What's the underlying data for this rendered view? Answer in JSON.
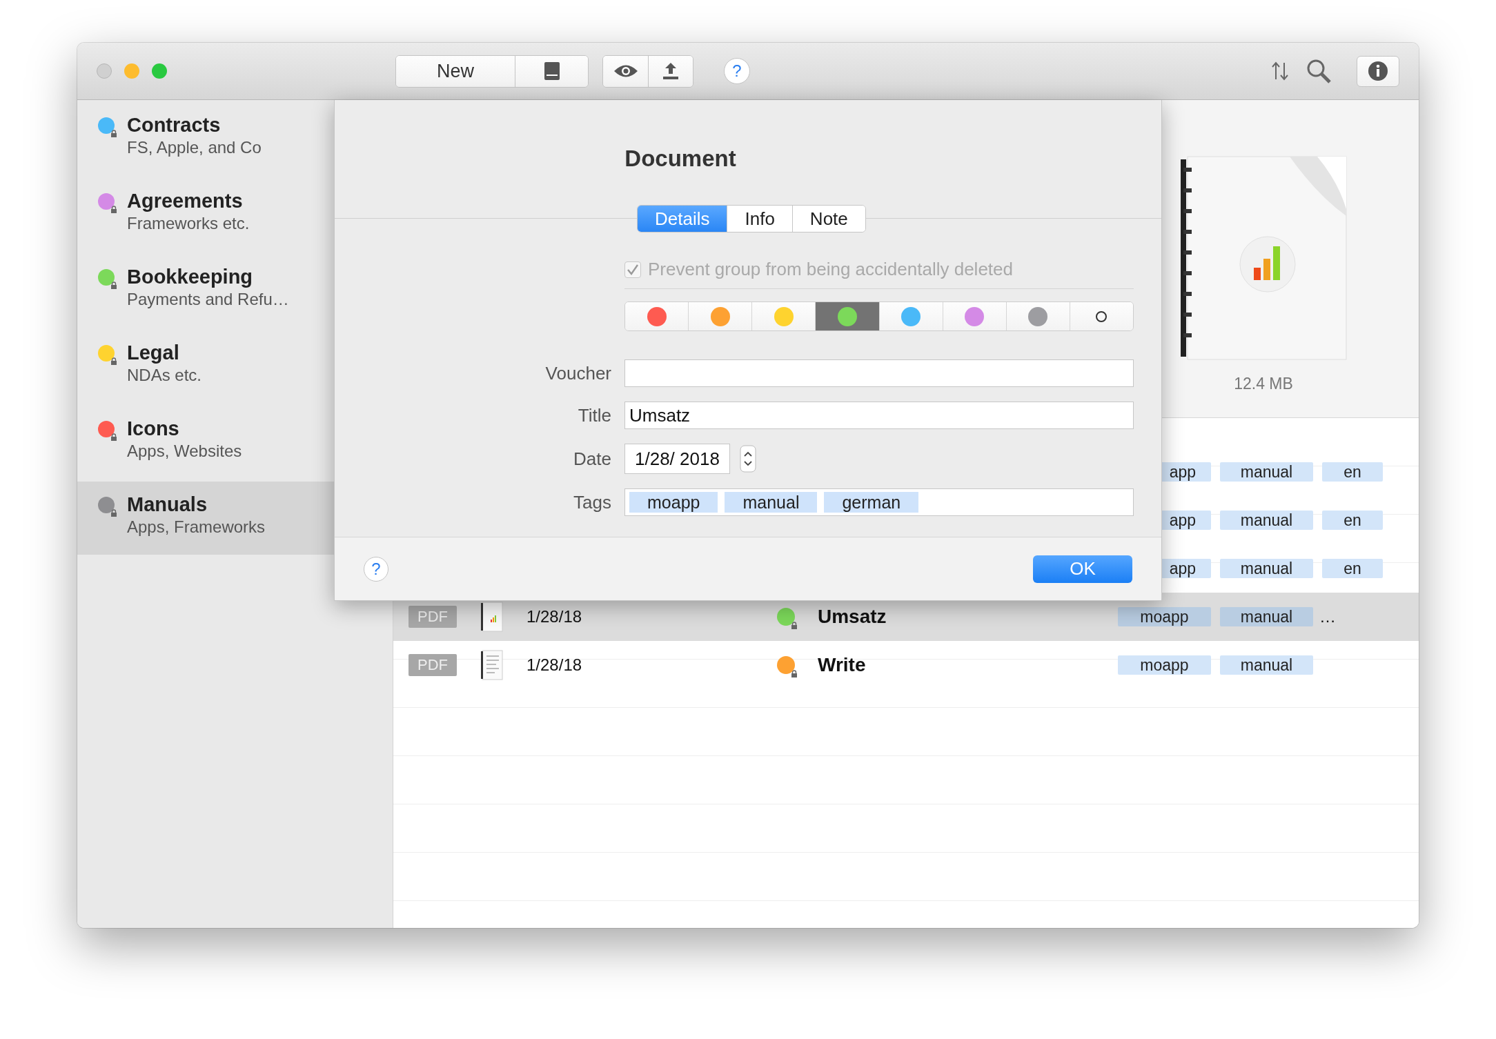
{
  "toolbar": {
    "new_button": "New",
    "help": "?"
  },
  "sidebar": {
    "items": [
      {
        "title": "Contracts",
        "subtitle": "FS, Apple, and Co",
        "color": "#4ab9f8",
        "selected": false
      },
      {
        "title": "Agreements",
        "subtitle": "Frameworks etc.",
        "color": "#d48ae6",
        "selected": false
      },
      {
        "title": "Bookkeeping",
        "subtitle": "Payments and Refu…",
        "color": "#7cd95a",
        "selected": false
      },
      {
        "title": "Legal",
        "subtitle": "NDAs etc.",
        "color": "#fed32f",
        "selected": false
      },
      {
        "title": "Icons",
        "subtitle": "Apps, Websites",
        "color": "#fe5b51",
        "selected": false
      },
      {
        "title": "Manuals",
        "subtitle": "Apps, Frameworks",
        "color": "#8e8e91",
        "selected": true
      }
    ]
  },
  "preview": {
    "size": "12.4 MB"
  },
  "list": {
    "rows": [
      {
        "covered": true,
        "tags": [
          "app",
          "manual",
          "en"
        ]
      },
      {
        "covered": true,
        "tags": [
          "app",
          "manual",
          "en"
        ]
      },
      {
        "covered": true,
        "tags": [
          "app",
          "manual",
          "en"
        ]
      },
      {
        "covered": false,
        "type": "PDF",
        "kind": "chart",
        "date": "1/28/18",
        "title": "Umsatz",
        "color": "#7cd95a",
        "selected": true,
        "tags": [
          "moapp",
          "manual"
        ],
        "more": "…"
      },
      {
        "covered": false,
        "type": "PDF",
        "kind": "text",
        "date": "1/28/18",
        "title": "Write",
        "color": "#fda132",
        "selected": false,
        "tags": [
          "moapp",
          "manual"
        ]
      }
    ]
  },
  "dialog": {
    "title": "Document",
    "tabs": [
      {
        "label": "Details",
        "selected": true
      },
      {
        "label": "Info",
        "selected": false
      },
      {
        "label": "Note",
        "selected": false
      }
    ],
    "protect": {
      "label": "Prevent group from being accidentally deleted",
      "checked": true,
      "disabled": true
    },
    "colors": [
      {
        "kind": "dot",
        "color": "#fe5b51",
        "selected": false
      },
      {
        "kind": "dot",
        "color": "#fda132",
        "selected": false
      },
      {
        "kind": "dot",
        "color": "#fed32f",
        "selected": false
      },
      {
        "kind": "dot",
        "color": "#7cd95a",
        "selected": true
      },
      {
        "kind": "dot",
        "color": "#4ab9f8",
        "selected": false
      },
      {
        "kind": "dot",
        "color": "#d48ae6",
        "selected": false
      },
      {
        "kind": "dot",
        "color": "#9d9da1",
        "selected": false
      },
      {
        "kind": "none",
        "selected": false
      }
    ],
    "fields": [
      {
        "kind": "text",
        "label": "Voucher"
      },
      {
        "kind": "text",
        "label": "Title",
        "value": "Umsatz"
      },
      {
        "kind": "date",
        "label": "Date",
        "value": "1/28/ 2018"
      },
      {
        "kind": "tags",
        "label": "Tags",
        "tags": [
          "moapp",
          "manual",
          "german"
        ]
      }
    ],
    "help": "?",
    "ok": "OK"
  }
}
